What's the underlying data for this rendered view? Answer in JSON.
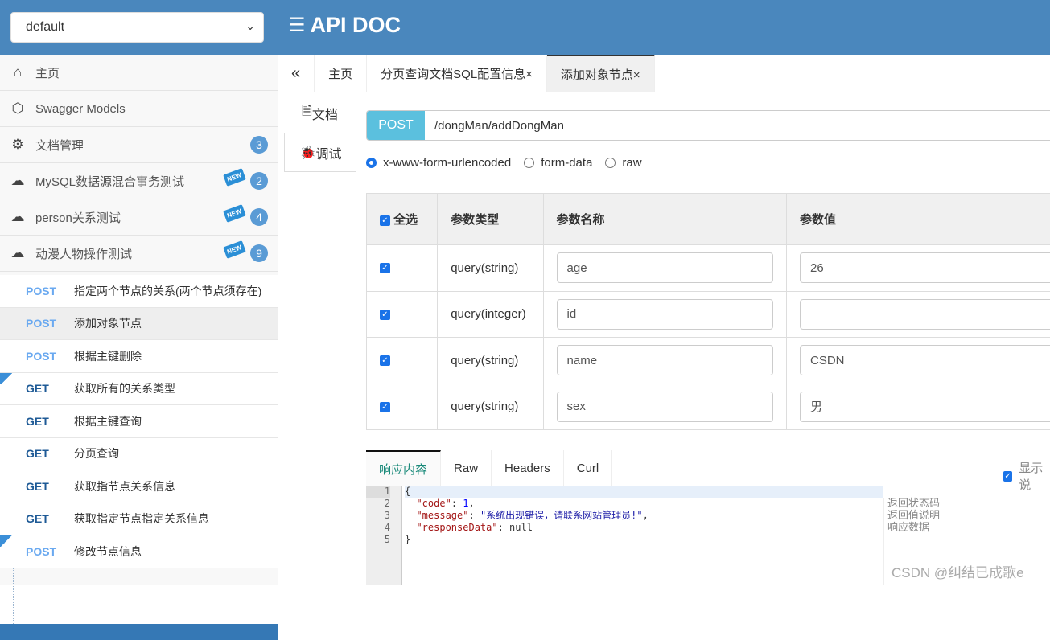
{
  "header": {
    "group_select": "default",
    "title": "API DOC"
  },
  "sidebar": {
    "menus": [
      {
        "label": "主页",
        "icon": "home-icon"
      },
      {
        "label": "Swagger Models",
        "icon": "models-icon"
      },
      {
        "label": "文档管理",
        "icon": "doc-settings-icon",
        "count": "3"
      },
      {
        "label": "MySQL数据源混合事务测试",
        "icon": "cloud-api-icon",
        "count": "2",
        "new": "NEW"
      },
      {
        "label": "person关系测试",
        "icon": "cloud-api-icon",
        "count": "4",
        "new": "NEW"
      },
      {
        "label": "动漫人物操作测试",
        "icon": "cloud-api-icon",
        "count": "9",
        "new": "NEW"
      }
    ],
    "apis": [
      {
        "method": "POST",
        "label": "指定两个节点的关系(两个节点须存在)"
      },
      {
        "method": "POST",
        "label": "添加对象节点",
        "active": true
      },
      {
        "method": "POST",
        "label": "根据主键删除"
      },
      {
        "method": "GET",
        "label": "获取所有的关系类型",
        "new": true
      },
      {
        "method": "GET",
        "label": "根据主键查询"
      },
      {
        "method": "GET",
        "label": "分页查询"
      },
      {
        "method": "GET",
        "label": "获取指节点关系信息"
      },
      {
        "method": "GET",
        "label": "获取指定节点指定关系信息"
      },
      {
        "method": "POST",
        "label": "修改节点信息",
        "new": true
      }
    ]
  },
  "tabs": {
    "collapse": "«",
    "items": [
      "主页",
      "分页查询文档SQL配置信息×",
      "添加对象节点×"
    ],
    "active": 2
  },
  "side_tabs": {
    "doc": "文档",
    "debug": "调试"
  },
  "request": {
    "method": "POST",
    "url": "/dongMan/addDongMan",
    "content_types": [
      "x-www-form-urlencoded",
      "form-data",
      "raw"
    ],
    "selected": 0
  },
  "params": {
    "headers": [
      "全选",
      "参数类型",
      "参数名称",
      "参数值"
    ],
    "rows": [
      {
        "type": "query(string)",
        "name": "age",
        "value": "26"
      },
      {
        "type": "query(integer)",
        "name": "id",
        "value": ""
      },
      {
        "type": "query(string)",
        "name": "name",
        "value": "CSDN"
      },
      {
        "type": "query(string)",
        "name": "sex",
        "value": "男"
      }
    ]
  },
  "response": {
    "tabs": [
      "响应内容",
      "Raw",
      "Headers",
      "Curl"
    ],
    "show_label": "显示说",
    "lines": [
      "1",
      "2",
      "3",
      "4",
      "5"
    ],
    "code_value": "1",
    "message_value": "\"系统出现错误，请联系网站管理员!\"",
    "notes": [
      "返回状态码",
      "返回值说明",
      "响应数据"
    ]
  },
  "watermark": "CSDN @纠结已成歌e",
  "colors": {
    "header": "#4a87bd",
    "post": "#6aa9f0",
    "get": "#1e5a96",
    "method_badge": "#5bc0de"
  }
}
